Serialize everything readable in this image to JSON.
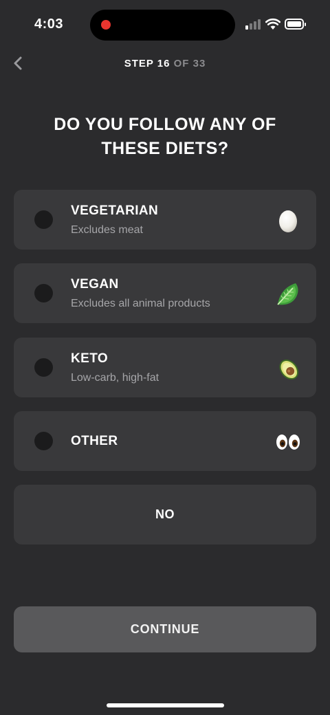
{
  "status_bar": {
    "time": "4:03"
  },
  "header": {
    "step_label": "STEP 16",
    "step_total": "OF 33"
  },
  "title": "DO YOU FOLLOW ANY OF THESE DIETS?",
  "options": [
    {
      "label": "VEGETARIAN",
      "subtitle": "Excludes meat",
      "icon": "egg-icon"
    },
    {
      "label": "VEGAN",
      "subtitle": "Excludes all animal products",
      "icon": "leafy-green-icon"
    },
    {
      "label": "KETO",
      "subtitle": "Low-carb, high-fat",
      "icon": "avocado-icon"
    },
    {
      "label": "OTHER",
      "subtitle": "",
      "icon": "eyes-icon"
    }
  ],
  "none_label": "NO",
  "continue_label": "CONTINUE",
  "colors": {
    "background": "#2b2b2d",
    "card": "#39393b",
    "button": "#59595b",
    "radio": "#1b1b1c",
    "subtext": "#a6a6a9"
  }
}
